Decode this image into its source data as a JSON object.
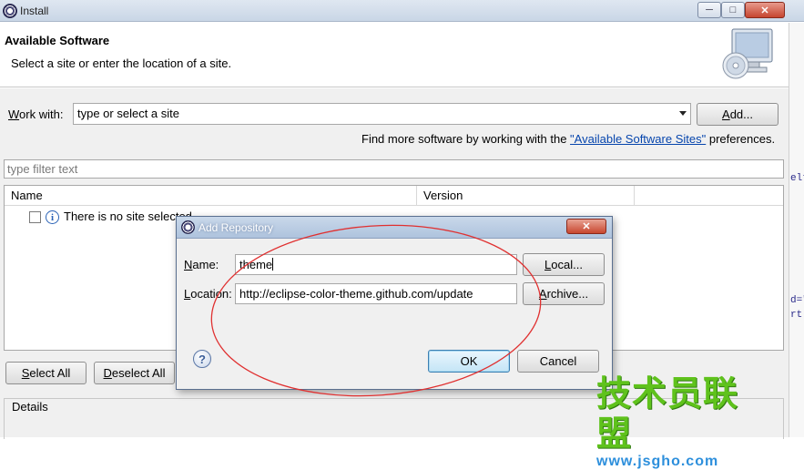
{
  "window": {
    "title": "Install",
    "controls": {
      "minimize": "─",
      "maximize": "□",
      "close": "✕"
    }
  },
  "header": {
    "title": "Available Software",
    "subtitle": "Select a site or enter the location of a site."
  },
  "work_with": {
    "label_mn": "W",
    "label_rest": "ork with:",
    "value": "type or select a site",
    "add_mn": "A",
    "add_rest": "dd..."
  },
  "find_more": {
    "prefix": "Find more software by working with the ",
    "link": "\"Available Software Sites\"",
    "suffix": " preferences."
  },
  "filter": {
    "placeholder": "type filter text"
  },
  "table": {
    "columns": [
      "Name",
      "Version"
    ],
    "message": "There is no site selected."
  },
  "buttons": {
    "select_all_mn": "S",
    "select_all_rest": "elect All",
    "deselect_all_mn": "D",
    "deselect_all_rest": "eselect All"
  },
  "details": {
    "label": "Details"
  },
  "background_fragments": [
    "elt",
    "d=\"",
    "rt"
  ],
  "watermark": {
    "text": "技术员联盟",
    "url": "www.jsgho.com"
  },
  "dialog": {
    "title": "Add Repository",
    "close": "✕",
    "name_mn": "N",
    "name_rest": "ame:",
    "name_value": "theme",
    "location_mn": "L",
    "location_rest": "ocation:",
    "location_value": "http://eclipse-color-theme.github.com/update",
    "local_pre": "",
    "local_mn": "L",
    "local_rest": "ocal...",
    "archive_pre": "",
    "archive_mn": "A",
    "archive_rest": "rchive...",
    "help": "?",
    "ok": "OK",
    "cancel": "Cancel"
  },
  "colors": {
    "annotation": "#e03030",
    "link": "#0645ad",
    "watermark_green": "#5fc21c",
    "watermark_blue": "#2d8fdc"
  }
}
